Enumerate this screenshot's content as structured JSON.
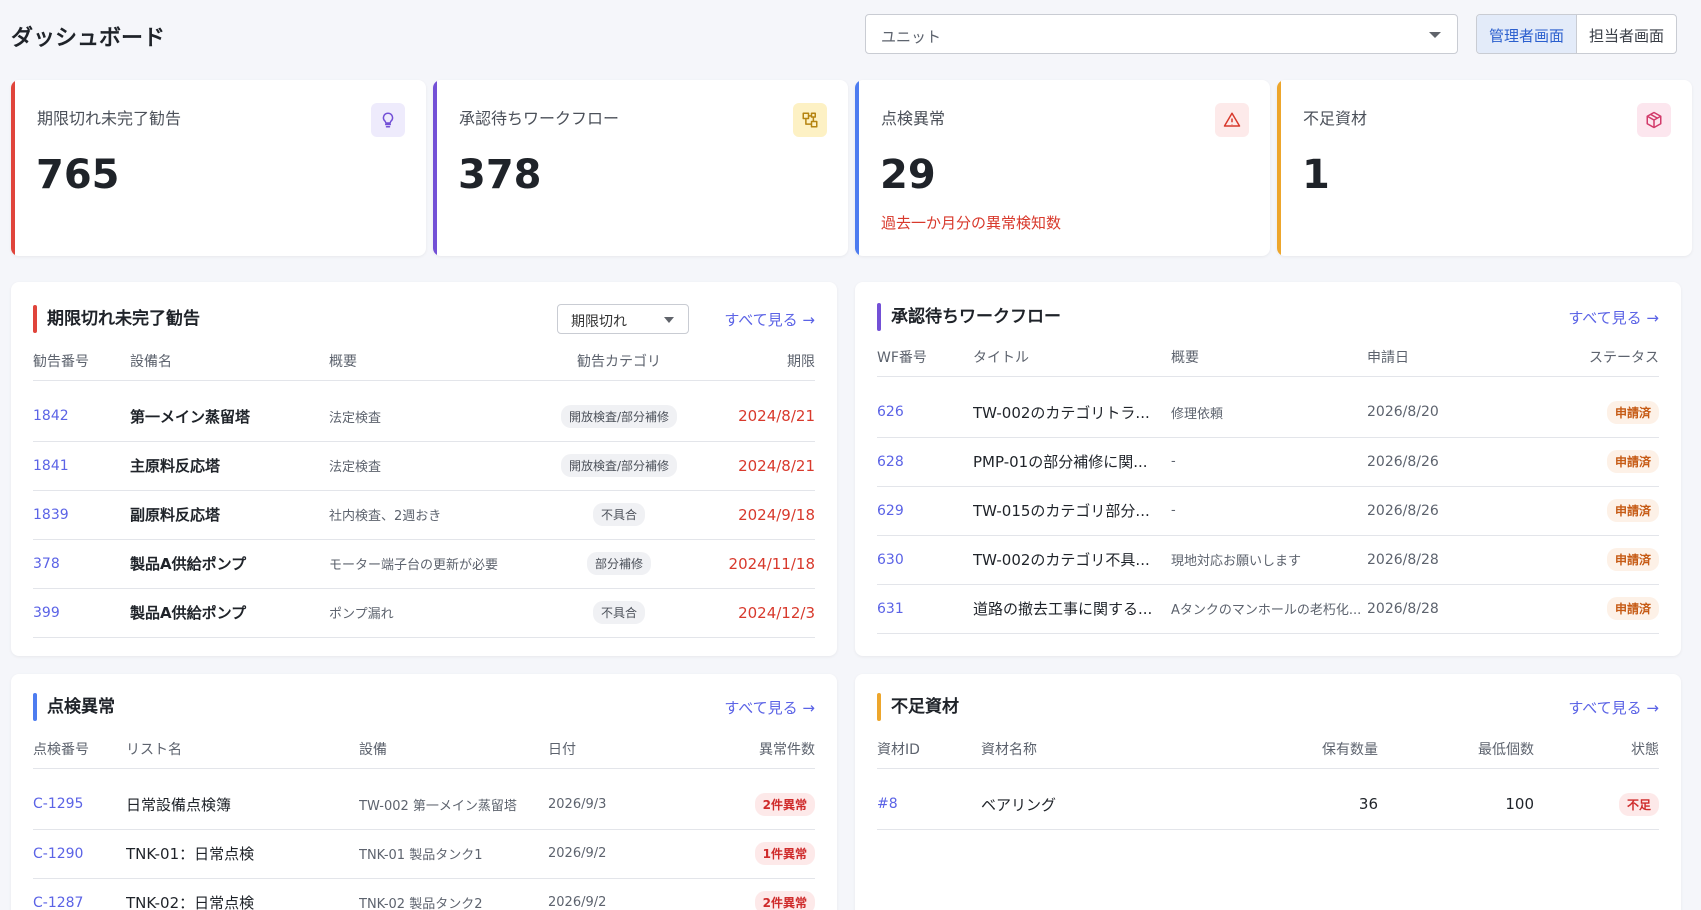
{
  "header": {
    "title": "ダッシュボード",
    "unit_placeholder": "ユニット",
    "view_toggle": [
      "管理者画面",
      "担当者画面"
    ]
  },
  "colors": {
    "red": "#e0443b",
    "purple": "#7350d6",
    "blue": "#4d7cf0",
    "orange": "#eda62c",
    "link": "#5b63e6"
  },
  "kpis": [
    {
      "label": "期限切れ未完了勧告",
      "value": "765",
      "note": "",
      "icon": "lightbulb-icon"
    },
    {
      "label": "承認待ちワークフロー",
      "value": "378",
      "note": "",
      "icon": "workflow-icon"
    },
    {
      "label": "点検異常",
      "value": "29",
      "note": "過去一か月分の異常検知数",
      "icon": "warning-icon"
    },
    {
      "label": "不足資材",
      "value": "1",
      "note": "",
      "icon": "box-icon"
    }
  ],
  "recommendations": {
    "title": "期限切れ未完了勧告",
    "filter": "期限切れ",
    "see_all": "すべて見る →",
    "columns": [
      "勧告番号",
      "設備名",
      "概要",
      "勧告カテゴリ",
      "期限"
    ],
    "rows": [
      {
        "id": "1842",
        "equipment": "第一メイン蒸留塔",
        "summary": "法定検査",
        "category": "開放検査/部分補修",
        "due": "2024/8/21"
      },
      {
        "id": "1841",
        "equipment": "主原料反応塔",
        "summary": "法定検査",
        "category": "開放検査/部分補修",
        "due": "2024/8/21"
      },
      {
        "id": "1839",
        "equipment": "副原料反応塔",
        "summary": "社内検査、2週おき",
        "category": "不具合",
        "due": "2024/9/18"
      },
      {
        "id": "378",
        "equipment": "製品A供給ポンプ",
        "summary": "モーター端子台の更新が必要",
        "category": "部分補修",
        "due": "2024/11/18"
      },
      {
        "id": "399",
        "equipment": "製品A供給ポンプ",
        "summary": "ポンプ漏れ",
        "category": "不具合",
        "due": "2024/12/3"
      }
    ]
  },
  "workflows": {
    "title": "承認待ちワークフロー",
    "see_all": "すべて見る →",
    "columns": [
      "WF番号",
      "タイトル",
      "概要",
      "申請日",
      "ステータス"
    ],
    "rows": [
      {
        "id": "626",
        "title": "TW-002のカテゴリトラ...",
        "summary": "修理依頼",
        "date": "2026/8/20",
        "status": "申請済"
      },
      {
        "id": "628",
        "title": "PMP-01の部分補修に関...",
        "summary": "-",
        "date": "2026/8/26",
        "status": "申請済"
      },
      {
        "id": "629",
        "title": "TW-015のカテゴリ部分...",
        "summary": "-",
        "date": "2026/8/26",
        "status": "申請済"
      },
      {
        "id": "630",
        "title": "TW-002のカテゴリ不具...",
        "summary": "現地対応お願いします",
        "date": "2026/8/28",
        "status": "申請済"
      },
      {
        "id": "631",
        "title": "道路の撤去工事に関する...",
        "summary": "Aタンクのマンホールの老朽化...",
        "date": "2026/8/28",
        "status": "申請済"
      }
    ]
  },
  "inspections": {
    "title": "点検異常",
    "see_all": "すべて見る →",
    "columns": [
      "点検番号",
      "リスト名",
      "設備",
      "日付",
      "異常件数"
    ],
    "rows": [
      {
        "id": "C-1295",
        "list": "日常設備点検簿",
        "equipment": "TW-002 第一メイン蒸留塔",
        "date": "2026/9/3",
        "count": "2件異常"
      },
      {
        "id": "C-1290",
        "list": "TNK-01：日常点検",
        "equipment": "TNK-01 製品タンク1",
        "date": "2026/9/2",
        "count": "1件異常"
      },
      {
        "id": "C-1287",
        "list": "TNK-02：日常点検",
        "equipment": "TNK-02 製品タンク2",
        "date": "2026/9/2",
        "count": "2件異常"
      }
    ]
  },
  "materials": {
    "title": "不足資材",
    "see_all": "すべて見る →",
    "columns": [
      "資材ID",
      "資材名称",
      "保有数量",
      "最低個数",
      "状態"
    ],
    "rows": [
      {
        "id": "#8",
        "name": "ベアリング",
        "stock": "36",
        "min": "100",
        "state": "不足"
      }
    ]
  }
}
